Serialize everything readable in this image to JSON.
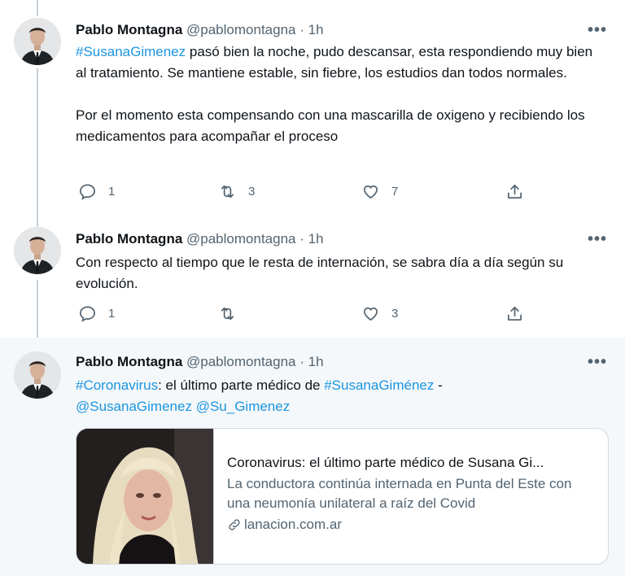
{
  "tweets": [
    {
      "name": "Pablo Montagna",
      "handle": "@pablomontagna",
      "sep": "·",
      "time": "1h",
      "more": "•••",
      "segments_p1": [
        {
          "t": "#SusanaGimenez",
          "link": true
        },
        {
          "t": " pasó bien la noche, pudo descansar, esta respondiendo muy bien al tratamiento. Se mantiene estable, sin fiebre, los estudios dan todos normales.",
          "link": false
        }
      ],
      "p2": "Por el momento esta compensando con una mascarilla de oxigeno y recibiendo los medicamentos para acompañar el proceso",
      "replies": "1",
      "retweets": "3",
      "likes": "7"
    },
    {
      "name": "Pablo Montagna",
      "handle": "@pablomontagna",
      "sep": "·",
      "time": "1h",
      "more": "•••",
      "p1": "Con respecto al tiempo que le resta de internación, se sabra día a día según su evolución.",
      "replies": "1",
      "retweets": "",
      "likes": "3"
    },
    {
      "name": "Pablo Montagna",
      "handle": "@pablomontagna",
      "sep": "·",
      "time": "1h",
      "more": "•••",
      "hashtag1": "#Coronavirus",
      "text1": ": el último parte médico de ",
      "hashtag2": "#SusanaGiménez",
      "text2": " -",
      "mention1": "@SusanaGimenez",
      "mention2": "@Su_Gimenez",
      "card": {
        "title": "Coronavirus: el último parte médico de Susana Gi...",
        "description": "La conductora continúa internada en Punta del Este con una neumonía unilateral a raíz del Covid",
        "domain": "lanacion.com.ar"
      }
    }
  ],
  "colors": {
    "link": "#1b95e0",
    "secondary": "#536471",
    "highlight_bg": "#f5f8fa",
    "thread_line": "#c4cfd6"
  },
  "icons": [
    "reply-icon",
    "retweet-icon",
    "like-icon",
    "share-icon",
    "link-icon",
    "more-icon"
  ]
}
